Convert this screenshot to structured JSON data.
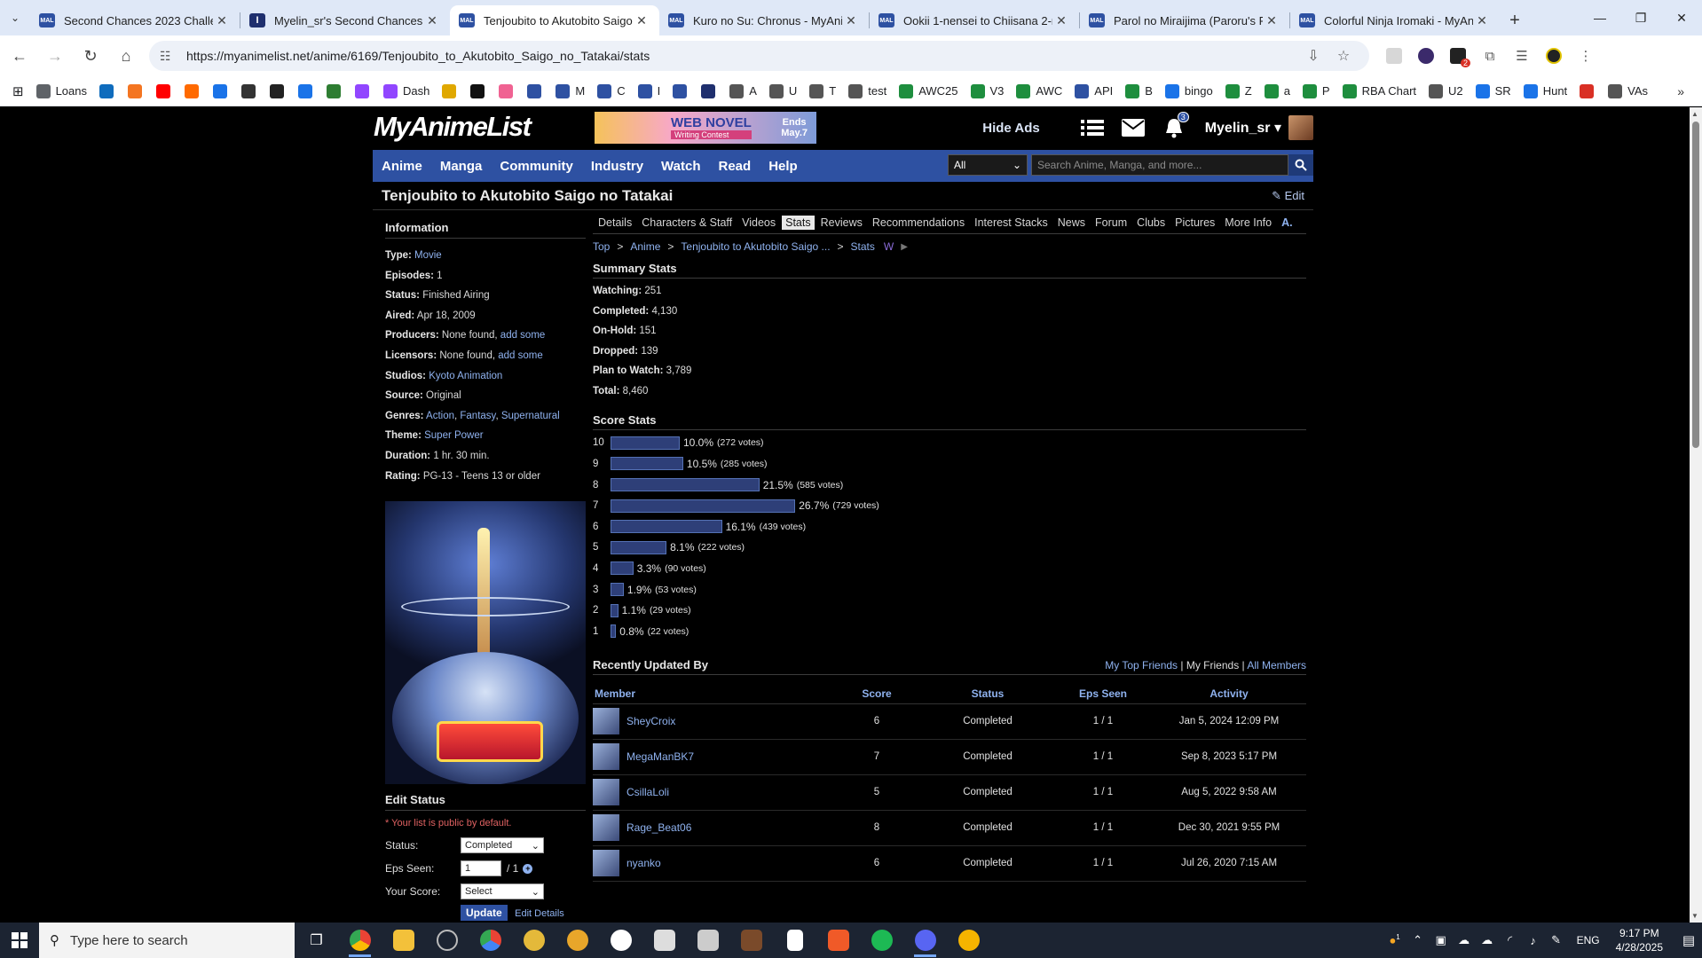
{
  "browser": {
    "tabs": [
      {
        "label": "Second Chances 2023 Challeng",
        "icon": "mal-favicon",
        "active": false
      },
      {
        "label": "Myelin_sr's Second Chances 20",
        "icon": "imdb-favicon",
        "active": false
      },
      {
        "label": "Tenjoubito to Akutobito Saigo",
        "icon": "mal-favicon",
        "active": true
      },
      {
        "label": "Kuro no Su: Chronus - MyAnim",
        "icon": "mal-favicon",
        "active": false
      },
      {
        "label": "Ookii 1-nensei to Chiisana 2-ne",
        "icon": "mal-favicon",
        "active": false
      },
      {
        "label": "Parol no Miraijima (Paroru's Fut",
        "icon": "mal-favicon",
        "active": false
      },
      {
        "label": "Colorful Ninja Iromaki - MyAnin",
        "icon": "mal-favicon",
        "active": false
      }
    ],
    "url": "https://myanimelist.net/anime/6169/Tenjoubito_to_Akutobito_Saigo_no_Tatakai/stats",
    "extension_badge": "2",
    "bookmarks": [
      {
        "label": "Loans",
        "icon": "folder-icon",
        "color": "#5f6368"
      },
      {
        "label": "",
        "icon": "outlook-icon",
        "color": "#0f6cbd"
      },
      {
        "label": "",
        "icon": "crunchyroll-icon",
        "color": "#f47521"
      },
      {
        "label": "",
        "icon": "youtube-icon",
        "color": "#ff0000"
      },
      {
        "label": "",
        "icon": "az-icon",
        "color": "#ff6a00"
      },
      {
        "label": "",
        "icon": "play-icon",
        "color": "#1a73e8"
      },
      {
        "label": "",
        "icon": "bm-icon",
        "color": "#333"
      },
      {
        "label": "",
        "icon": "amazon-icon",
        "color": "#222"
      },
      {
        "label": "",
        "icon": "shield-icon",
        "color": "#1a73e8"
      },
      {
        "label": "",
        "icon": "hex-icon",
        "color": "#2e7d32"
      },
      {
        "label": "",
        "icon": "twitch-icon",
        "color": "#9146ff"
      },
      {
        "label": "Dash",
        "icon": "twitch-icon",
        "color": "#9146ff"
      },
      {
        "label": "",
        "icon": "trophy-icon",
        "color": "#e0a800"
      },
      {
        "label": "",
        "icon": "circle-icon",
        "color": "#111"
      },
      {
        "label": "",
        "icon": "anilist-icon",
        "color": "#f06292"
      },
      {
        "label": "",
        "icon": "mal-icon",
        "color": "#2e51a2"
      },
      {
        "label": "M",
        "icon": "mal-icon",
        "color": "#2e51a2"
      },
      {
        "label": "C",
        "icon": "mal-icon",
        "color": "#2e51a2"
      },
      {
        "label": "I",
        "icon": "mal-icon",
        "color": "#2e51a2"
      },
      {
        "label": "",
        "icon": "mal-icon",
        "color": "#2e51a2"
      },
      {
        "label": "",
        "icon": "t-icon",
        "color": "#1f2f6e"
      },
      {
        "label": "A",
        "icon": "globe-icon",
        "color": "#555"
      },
      {
        "label": "U",
        "icon": "globe-icon",
        "color": "#555"
      },
      {
        "label": "T",
        "icon": "globe-icon",
        "color": "#555"
      },
      {
        "label": "test",
        "icon": "globe-icon",
        "color": "#555"
      },
      {
        "label": "AWC25",
        "icon": "sheets-icon",
        "color": "#1e8e3e"
      },
      {
        "label": "V3",
        "icon": "sheets-icon",
        "color": "#1e8e3e"
      },
      {
        "label": "AWC",
        "icon": "sheets-icon",
        "color": "#1e8e3e"
      },
      {
        "label": "API",
        "icon": "mal-icon",
        "color": "#2e51a2"
      },
      {
        "label": "B",
        "icon": "sheets-icon",
        "color": "#1e8e3e"
      },
      {
        "label": "bingo",
        "icon": "docs-icon",
        "color": "#1a73e8"
      },
      {
        "label": "Z",
        "icon": "sheets-icon",
        "color": "#1e8e3e"
      },
      {
        "label": "a",
        "icon": "sheets-icon",
        "color": "#1e8e3e"
      },
      {
        "label": "P",
        "icon": "sheets-icon",
        "color": "#1e8e3e"
      },
      {
        "label": "RBA Chart",
        "icon": "sheets-icon",
        "color": "#1e8e3e"
      },
      {
        "label": "U2",
        "icon": "globe-icon",
        "color": "#555"
      },
      {
        "label": "SR",
        "icon": "drive-icon",
        "color": "#1a73e8"
      },
      {
        "label": "Hunt",
        "icon": "drive-icon",
        "color": "#1a73e8"
      },
      {
        "label": "",
        "icon": "square-icon",
        "color": "#d93025"
      },
      {
        "label": "VAs",
        "icon": "globe-icon",
        "color": "#555"
      }
    ]
  },
  "header": {
    "logo": "MyAnimeList",
    "ad": {
      "line1": "WEB NOVEL",
      "line2": "Writing Contest",
      "ends": "Ends",
      "date": "May.7"
    },
    "hide_ads": "Hide Ads",
    "notif_count": "3",
    "username": "Myelin_sr"
  },
  "nav": {
    "items": [
      "Anime",
      "Manga",
      "Community",
      "Industry",
      "Watch",
      "Read",
      "Help"
    ],
    "search_category": "All",
    "search_placeholder": "Search Anime, Manga, and more..."
  },
  "page": {
    "title": "Tenjoubito to Akutobito Saigo no Tatakai",
    "edit": "Edit"
  },
  "info": {
    "heading": "Information",
    "rows": [
      {
        "label": "Type:",
        "value": "Movie",
        "link": true
      },
      {
        "label": "Episodes:",
        "value": "1",
        "link": false
      },
      {
        "label": "Status:",
        "value": "Finished Airing",
        "link": false
      },
      {
        "label": "Aired:",
        "value": "Apr 18, 2009",
        "link": false
      }
    ],
    "producers_label": "Producers:",
    "producers_value": "None found,",
    "producers_link": "add some",
    "licensors_label": "Licensors:",
    "licensors_value": "None found,",
    "licensors_link": "add some",
    "studios_label": "Studios:",
    "studios_value": "Kyoto Animation",
    "source_label": "Source:",
    "source_value": "Original",
    "genres_label": "Genres:",
    "genres": [
      "Action",
      "Fantasy",
      "Supernatural"
    ],
    "theme_label": "Theme:",
    "theme_value": "Super Power",
    "duration_label": "Duration:",
    "duration_value": "1 hr. 30 min.",
    "rating_label": "Rating:",
    "rating_value": "PG-13 - Teens 13 or older"
  },
  "edit_status": {
    "heading": "Edit Status",
    "note": "* Your list is public by default.",
    "status_label": "Status:",
    "status_value": "Completed",
    "eps_label": "Eps Seen:",
    "eps_value": "1",
    "eps_total": "/ 1",
    "score_label": "Your Score:",
    "score_value": "Select",
    "update": "Update",
    "edit_details": "Edit Details"
  },
  "subtabs": [
    "Details",
    "Characters & Staff",
    "Videos",
    "Stats",
    "Reviews",
    "Recommendations",
    "Interest Stacks",
    "News",
    "Forum",
    "Clubs",
    "Pictures",
    "More Info"
  ],
  "active_subtab": "Stats",
  "breadcrumb": [
    "Top",
    "Anime",
    "Tenjoubito to Akutobito Saigo ...",
    "Stats"
  ],
  "summary": {
    "heading": "Summary Stats",
    "rows": [
      {
        "label": "Watching:",
        "value": "251"
      },
      {
        "label": "Completed:",
        "value": "4,130"
      },
      {
        "label": "On-Hold:",
        "value": "151"
      },
      {
        "label": "Dropped:",
        "value": "139"
      },
      {
        "label": "Plan to Watch:",
        "value": "3,789"
      },
      {
        "label": "Total:",
        "value": "8,460"
      }
    ]
  },
  "score_stats": {
    "heading": "Score Stats",
    "rows": [
      {
        "score": "10",
        "pct": 10.0,
        "pct_label": "10.0%",
        "votes": "(272 votes)"
      },
      {
        "score": "9",
        "pct": 10.5,
        "pct_label": "10.5%",
        "votes": "(285 votes)"
      },
      {
        "score": "8",
        "pct": 21.5,
        "pct_label": "21.5%",
        "votes": "(585 votes)"
      },
      {
        "score": "7",
        "pct": 26.7,
        "pct_label": "26.7%",
        "votes": "(729 votes)"
      },
      {
        "score": "6",
        "pct": 16.1,
        "pct_label": "16.1%",
        "votes": "(439 votes)"
      },
      {
        "score": "5",
        "pct": 8.1,
        "pct_label": "8.1%",
        "votes": "(222 votes)"
      },
      {
        "score": "4",
        "pct": 3.3,
        "pct_label": "3.3%",
        "votes": "(90 votes)"
      },
      {
        "score": "3",
        "pct": 1.9,
        "pct_label": "1.9%",
        "votes": "(53 votes)"
      },
      {
        "score": "2",
        "pct": 1.1,
        "pct_label": "1.1%",
        "votes": "(29 votes)"
      },
      {
        "score": "1",
        "pct": 0.8,
        "pct_label": "0.8%",
        "votes": "(22 votes)"
      }
    ]
  },
  "recent": {
    "heading": "Recently Updated By",
    "links": [
      "My Top Friends",
      "My Friends",
      "All Members"
    ],
    "columns": [
      "Member",
      "Score",
      "Status",
      "Eps Seen",
      "Activity"
    ],
    "rows": [
      {
        "member": "SheyCroix",
        "score": "6",
        "status": "Completed",
        "eps": "1 / 1",
        "activity": "Jan 5, 2024 12:09 PM"
      },
      {
        "member": "MegaManBK7",
        "score": "7",
        "status": "Completed",
        "eps": "1 / 1",
        "activity": "Sep 8, 2023 5:17 PM"
      },
      {
        "member": "CsillaLoli",
        "score": "5",
        "status": "Completed",
        "eps": "1 / 1",
        "activity": "Aug 5, 2022 9:58 AM"
      },
      {
        "member": "Rage_Beat06",
        "score": "8",
        "status": "Completed",
        "eps": "1 / 1",
        "activity": "Dec 30, 2021 9:55 PM"
      },
      {
        "member": "nyanko",
        "score": "6",
        "status": "Completed",
        "eps": "1 / 1",
        "activity": "Jul 26, 2020 7:15 AM"
      }
    ]
  },
  "taskbar": {
    "search_placeholder": "Type here to search",
    "lang": "ENG",
    "time": "9:17 PM",
    "date": "4/28/2025",
    "weather_badge": "1"
  },
  "colors": {
    "mal_blue": "#2e51a2",
    "link": "#8fb2ef",
    "bar_fill": "#2e3f78"
  }
}
